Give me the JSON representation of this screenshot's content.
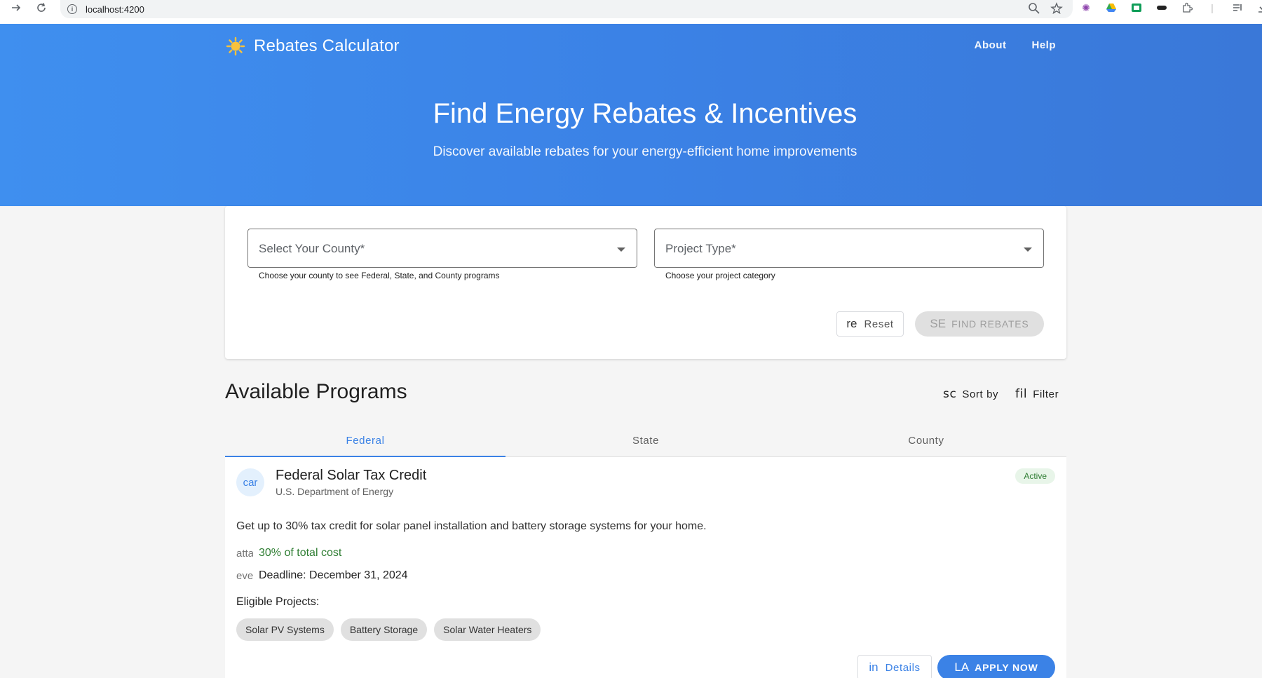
{
  "browser": {
    "url": "localhost:4200",
    "icons": {
      "back": "arrow-right-icon",
      "reload": "reload-icon",
      "info": "info-icon",
      "zoom": "zoom-icon",
      "bookmark": "star-icon"
    }
  },
  "header": {
    "brand_icon": "sun-icon",
    "brand_title": "Rebates Calculator",
    "nav": [
      {
        "label": "About"
      },
      {
        "label": "Help"
      }
    ]
  },
  "hero": {
    "title": "Find Energy Rebates & Incentives",
    "subtitle": "Discover available rebates for your energy-efficient home improvements"
  },
  "search": {
    "county_placeholder": "Select Your County*",
    "county_hint": "Choose your county to see Federal, State, and County programs",
    "project_placeholder": "Project Type*",
    "project_hint": "Choose your project category",
    "reset_icon_text": "re",
    "reset_label": "Reset",
    "find_icon_text": "SE",
    "find_label": "FIND REBATES"
  },
  "programs": {
    "title": "Available Programs",
    "sort_icon_text": "sc",
    "sort_label": "Sort by",
    "filter_icon_text": "fil",
    "filter_label": "Filter",
    "tabs": [
      {
        "label": "Federal",
        "active": true
      },
      {
        "label": "State",
        "active": false
      },
      {
        "label": "County",
        "active": false
      }
    ]
  },
  "program_card": {
    "avatar_text": "car",
    "title": "Federal Solar Tax Credit",
    "agency": "U.S. Department of Energy",
    "status": "Active",
    "description": "Get up to 30% tax credit for solar panel installation and battery storage systems for your home.",
    "amount_icon_text": "attach",
    "amount": "30% of total cost",
    "deadline_icon_text": "event",
    "deadline": "Deadline: December 31, 2024",
    "eligible_label": "Eligible Projects:",
    "eligible_projects": [
      "Solar PV Systems",
      "Battery Storage",
      "Solar Water Heaters"
    ],
    "details_icon_text": "in",
    "details_label": "Details",
    "apply_icon_text": "LA",
    "apply_label": "APPLY NOW"
  },
  "colors": {
    "primary": "#3b82e6",
    "success": "#2e7d32",
    "page_bg": "#f5f5f5"
  }
}
